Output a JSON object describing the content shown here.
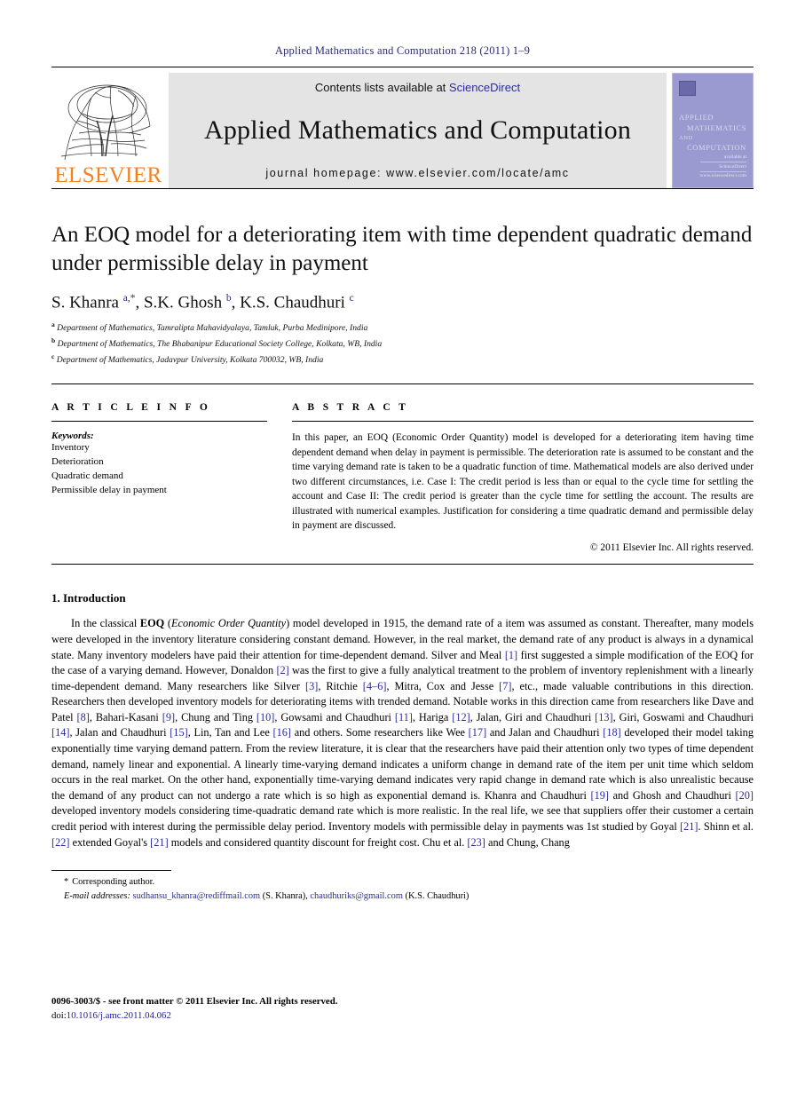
{
  "running_head": "Applied Mathematics and Computation 218 (2011) 1–9",
  "masthead": {
    "contents_prefix": "Contents lists available at ",
    "sciencedirect": "ScienceDirect",
    "journal_title": "Applied Mathematics and Computation",
    "homepage": "journal homepage: www.elsevier.com/locate/amc",
    "publisher_word": "ELSEVIER",
    "publisher_color": "#f4801f",
    "link_color": "#2b2b9e",
    "cover": {
      "line1": "APPLIED",
      "line2": "MATHEMATICS",
      "line3": "AND",
      "line4": "COMPUTATION",
      "badge_top": "available at",
      "badge": "ScienceDirect",
      "badge_sub": "www.sciencedirect.com"
    }
  },
  "article": {
    "title": "An EOQ model for a deteriorating item with time dependent quadratic demand under permissible delay in payment",
    "authors_html": "S. Khanra <sup>a,*</sup>, S.K. Ghosh <sup>b</sup>, K.S. Chaudhuri <sup>c</sup>",
    "affiliations": [
      "Department of Mathematics, Tamralipta Mahavidyalaya, Tamluk, Purba Medinipore, India",
      "Department of Mathematics, The Bhabanipur Educational Society College, Kolkata, WB, India",
      "Department of Mathematics, Jadavpur University, Kolkata 700032, WB, India"
    ],
    "affiliation_marks": [
      "a",
      "b",
      "c"
    ]
  },
  "article_info": {
    "heading": "A R T I C L E   I N F O",
    "keywords_label": "Keywords:",
    "keywords": [
      "Inventory",
      "Deterioration",
      "Quadratic demand",
      "Permissible delay in payment"
    ]
  },
  "abstract": {
    "heading": "A B S T R A C T",
    "text": "In this paper, an EOQ (Economic Order Quantity) model is developed for a deteriorating item having time dependent demand when delay in payment is permissible. The deterioration rate is assumed to be constant and the time varying demand rate is taken to be a quadratic function of time. Mathematical models are also derived under two different circumstances, i.e. Case I: The credit period is less than or equal to the cycle time for settling the account and Case II: The credit period is greater than the cycle time for settling the account. The results are illustrated with numerical examples. Justification for considering a time quadratic demand and permissible delay in payment are discussed.",
    "copyright": "© 2011 Elsevier Inc. All rights reserved."
  },
  "introduction": {
    "heading": "1. Introduction",
    "paragraph_segments": [
      {
        "t": "In the classical ",
        "s": "plain"
      },
      {
        "t": "EOQ",
        "s": "bold"
      },
      {
        "t": " (",
        "s": "plain"
      },
      {
        "t": "Economic Order Quantity",
        "s": "italic"
      },
      {
        "t": ") model developed in 1915, the demand rate of a item was assumed as constant. Thereafter, many models were developed in the inventory literature considering constant demand. However, in the real market, the demand rate of any product is always in a dynamical state. Many inventory modelers have paid their attention for time-dependent demand. Silver and Meal ",
        "s": "plain"
      },
      {
        "t": "[1]",
        "s": "cite"
      },
      {
        "t": " first suggested a simple modification of the EOQ for the case of a varying demand. However, Donaldon ",
        "s": "plain"
      },
      {
        "t": "[2]",
        "s": "cite"
      },
      {
        "t": " was the first to give a fully analytical treatment to the problem of inventory replenishment with a linearly time-dependent demand. Many researchers like Silver ",
        "s": "plain"
      },
      {
        "t": "[3]",
        "s": "cite"
      },
      {
        "t": ", Ritchie ",
        "s": "plain"
      },
      {
        "t": "[4–6]",
        "s": "cite"
      },
      {
        "t": ", Mitra, Cox and Jesse ",
        "s": "plain"
      },
      {
        "t": "[7]",
        "s": "cite"
      },
      {
        "t": ", etc., made valuable contributions in this direction. Researchers then developed inventory models for deteriorating items with trended demand. Notable works in this direction came from researchers like Dave and Patel ",
        "s": "plain"
      },
      {
        "t": "[8]",
        "s": "cite"
      },
      {
        "t": ", Bahari-Kasani ",
        "s": "plain"
      },
      {
        "t": "[9]",
        "s": "cite"
      },
      {
        "t": ", Chung and Ting ",
        "s": "plain"
      },
      {
        "t": "[10]",
        "s": "cite"
      },
      {
        "t": ", Gowsami and Chaudhuri ",
        "s": "plain"
      },
      {
        "t": "[11]",
        "s": "cite"
      },
      {
        "t": ", Hariga ",
        "s": "plain"
      },
      {
        "t": "[12]",
        "s": "cite"
      },
      {
        "t": ", Jalan, Giri and Chaudhuri ",
        "s": "plain"
      },
      {
        "t": "[13]",
        "s": "cite"
      },
      {
        "t": ", Giri, Goswami and Chaudhuri ",
        "s": "plain"
      },
      {
        "t": "[14]",
        "s": "cite"
      },
      {
        "t": ", Jalan and Chaudhuri ",
        "s": "plain"
      },
      {
        "t": "[15]",
        "s": "cite"
      },
      {
        "t": ", Lin, Tan and Lee ",
        "s": "plain"
      },
      {
        "t": "[16]",
        "s": "cite"
      },
      {
        "t": " and others. Some researchers like Wee ",
        "s": "plain"
      },
      {
        "t": "[17]",
        "s": "cite"
      },
      {
        "t": " and Jalan and Chaudhuri ",
        "s": "plain"
      },
      {
        "t": "[18]",
        "s": "cite"
      },
      {
        "t": " developed their model taking exponentially time varying demand pattern. From the review literature, it is clear that the researchers have paid their attention only two types of time dependent demand, namely linear and exponential. A linearly time-varying demand indicates a uniform change in demand rate of the item per unit time which seldom occurs in the real market. On the other hand, exponentially time-varying demand indicates very rapid change in demand rate which is also unrealistic because the demand of any product can not undergo a rate which is so high as exponential demand is. Khanra and Chaudhuri ",
        "s": "plain"
      },
      {
        "t": "[19]",
        "s": "cite"
      },
      {
        "t": " and Ghosh and Chaudhuri ",
        "s": "plain"
      },
      {
        "t": "[20]",
        "s": "cite"
      },
      {
        "t": " developed inventory models considering time-quadratic demand rate which is more realistic. In the real life, we see that suppliers offer their customer a certain credit period with interest during the permissible delay period. Inventory models with permissible delay in payments was 1st studied by Goyal ",
        "s": "plain"
      },
      {
        "t": "[21]",
        "s": "cite"
      },
      {
        "t": ". Shinn et al. ",
        "s": "plain"
      },
      {
        "t": "[22]",
        "s": "cite"
      },
      {
        "t": " extended Goyal's ",
        "s": "plain"
      },
      {
        "t": "[21]",
        "s": "cite"
      },
      {
        "t": " models and considered quantity discount for freight cost. Chu et al. ",
        "s": "plain"
      },
      {
        "t": "[23]",
        "s": "cite"
      },
      {
        "t": " and Chung, Chang",
        "s": "plain"
      }
    ]
  },
  "footnotes": {
    "corresponding_star": "*",
    "corresponding_text": "Corresponding author.",
    "email_label": "E-mail addresses:",
    "emails": [
      {
        "address": "sudhansu_khanra@rediffmail.com",
        "owner": "(S. Khanra)"
      },
      {
        "address": "chaudhuriks@gmail.com",
        "owner": "(K.S. Chaudhuri)"
      }
    ]
  },
  "footer": {
    "issn_line": "0096-3003/$ - see front matter © 2011 Elsevier Inc. All rights reserved.",
    "doi_label": "doi:",
    "doi": "10.1016/j.amc.2011.04.062"
  }
}
